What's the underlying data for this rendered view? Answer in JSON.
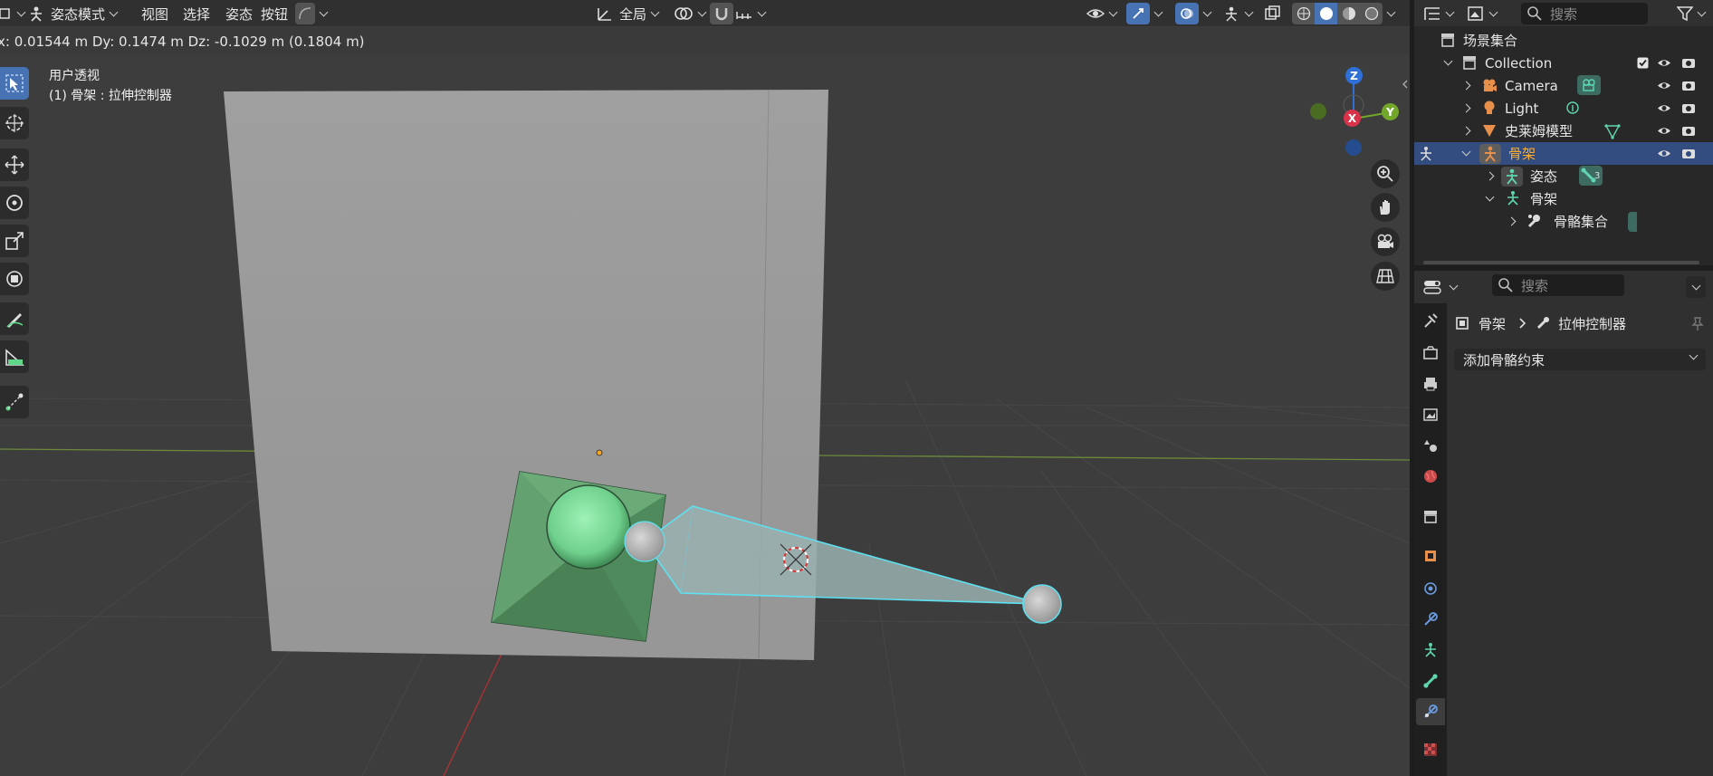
{
  "header": {
    "mode_label": "姿态模式",
    "menus": [
      "视图",
      "选择",
      "姿态",
      "按钮"
    ],
    "transform_orientation": "全局"
  },
  "status_bar": {
    "transform_readout": "x: 0.01544 m   Dy: 0.1474 m   Dz: -0.1029 m (0.1804 m)"
  },
  "viewport": {
    "view_name": "用户透视",
    "active_object": "(1) 骨架 : 拉伸控制器",
    "gizmo": {
      "x_label": "X",
      "y_label": "Y",
      "z_label": "Z"
    }
  },
  "outliner": {
    "search_placeholder": "搜索",
    "scene_collection": "场景集合",
    "items": [
      {
        "label": "Collection",
        "icon": "collection-icon"
      },
      {
        "label": "Camera",
        "icon": "camera-object-icon"
      },
      {
        "label": "Light",
        "icon": "light-object-icon"
      },
      {
        "label": "史莱姆模型",
        "icon": "mesh-object-icon"
      },
      {
        "label": "骨架",
        "icon": "armature-object-icon"
      },
      {
        "label": "姿态",
        "icon": "pose-icon",
        "badge": "3"
      },
      {
        "label": "骨架",
        "icon": "armature-data-icon"
      },
      {
        "label": "骨骼集合",
        "icon": "bone-collections-icon"
      }
    ]
  },
  "properties": {
    "search_placeholder": "搜索",
    "breadcrumb": {
      "object": "骨架",
      "bone": "拉伸控制器"
    },
    "add_constraint_label": "添加骨骼约束"
  },
  "colors": {
    "accent_blue": "#4772b3",
    "selected_row": "#334d80",
    "active_text": "#ffaf29",
    "bone_outline": "#5de0f0",
    "mesh_green": "#5c9a6a"
  }
}
